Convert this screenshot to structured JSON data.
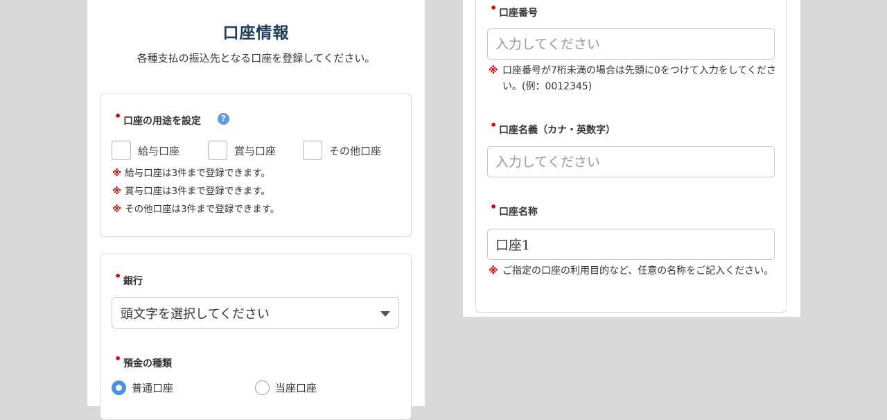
{
  "left": {
    "title": "口座情報",
    "subtitle": "各種支払の振込先となる口座を登録してください。",
    "usage": {
      "label": "口座の用途を設定",
      "help": "?",
      "options": [
        "給与口座",
        "賞与口座",
        "その他口座"
      ],
      "notes": [
        "給与口座は3件まで登録できます。",
        "賞与口座は3件まで登録できます。",
        "その他口座は3件まで登録できます。"
      ]
    },
    "bank": {
      "label": "銀行",
      "select_value": "頭文字を選択してください"
    },
    "deposit": {
      "label": "預金の種類",
      "options": [
        "普通口座",
        "当座口座"
      ],
      "selected": "普通口座"
    }
  },
  "right": {
    "account_number": {
      "label": "口座番号",
      "placeholder": "入力してください",
      "note": "口座番号が7桁未満の場合は先頭に0をつけて入力をしてください。(例：0012345)"
    },
    "account_holder": {
      "label": "口座名義（カナ・英数字）",
      "placeholder": "入力してください"
    },
    "account_name": {
      "label": "口座名称",
      "value": "口座1",
      "note": "ご指定の口座の利用目的など、任意の名称をご記入ください。"
    }
  },
  "note_mark": "※",
  "required_mark": "•",
  "colors": {
    "background": "#d9d9d9",
    "title": "#1d3e5a",
    "required": "#e00000",
    "accent": "#4a90e2"
  }
}
